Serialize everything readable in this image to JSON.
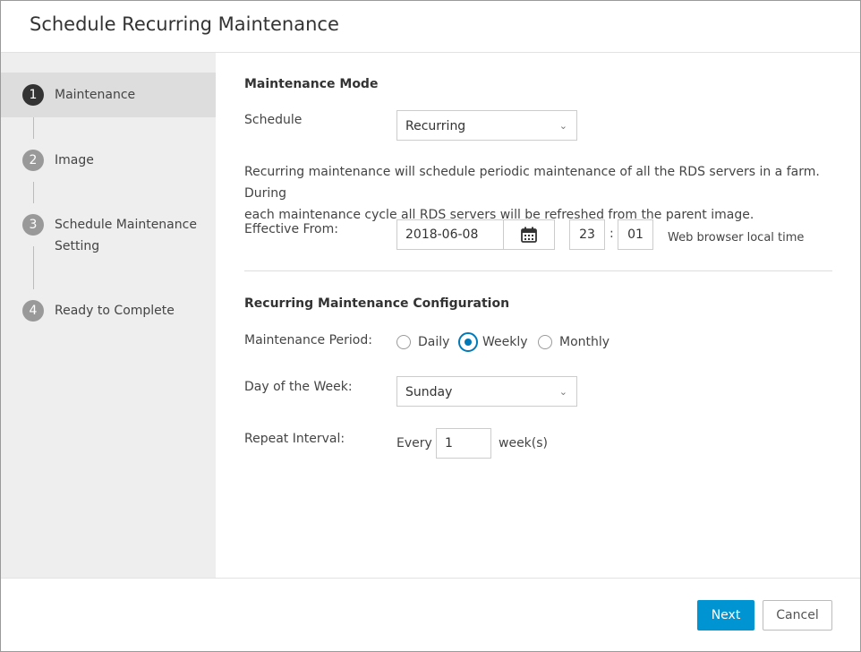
{
  "dialog": {
    "title": "Schedule Recurring Maintenance"
  },
  "wizard": {
    "steps": [
      {
        "number": "1",
        "label": "Maintenance",
        "active": true
      },
      {
        "number": "2",
        "label": "Image",
        "active": false
      },
      {
        "number": "3",
        "label_line1": "Schedule Maintenance",
        "label_line2": "Setting",
        "active": false
      },
      {
        "number": "4",
        "label": "Ready to Complete",
        "active": false
      }
    ]
  },
  "maintenance_mode": {
    "section_title": "Maintenance Mode",
    "schedule_label": "Schedule",
    "schedule_value": "Recurring",
    "description_line1": "Recurring maintenance will schedule periodic maintenance of all the RDS servers in a farm. During",
    "description_line2": "each maintenance cycle all RDS servers will be refreshed from the parent image.",
    "effective_from_label": "Effective From:",
    "date_value": "2018-06-08",
    "hour_value": "23",
    "time_separator": ":",
    "minute_value": "01",
    "timezone_note": "Web browser local time"
  },
  "recurring_config": {
    "section_title": "Recurring Maintenance Configuration",
    "period_label": "Maintenance Period:",
    "period_options": [
      {
        "label": "Daily",
        "checked": false
      },
      {
        "label": "Weekly",
        "checked": true
      },
      {
        "label": "Monthly",
        "checked": false
      }
    ],
    "day_label": "Day of the Week:",
    "day_value": "Sunday",
    "repeat_label": "Repeat Interval:",
    "repeat_prefix": "Every",
    "repeat_value": "1",
    "repeat_suffix": "week(s)"
  },
  "footer": {
    "next_label": "Next",
    "cancel_label": "Cancel"
  },
  "colors": {
    "primary_button": "#0094d2",
    "radio_checked": "#0079b8",
    "active_step_bg": "#dddddd",
    "sidebar_bg": "#eeeeee"
  },
  "icons": {
    "calendar": "calendar-icon",
    "dropdown": "chevron-down-icon"
  }
}
